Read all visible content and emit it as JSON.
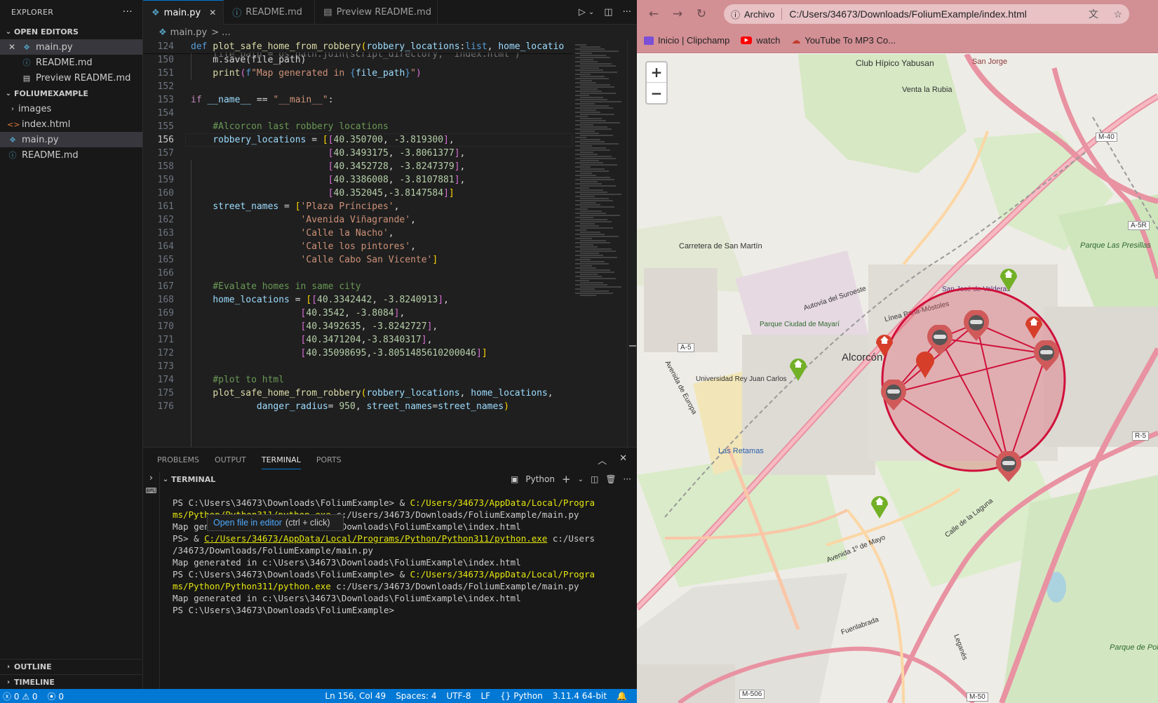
{
  "sidebar": {
    "title": "EXPLORER",
    "open_editors": "OPEN EDITORS",
    "open_files": [
      "main.py",
      "README.md",
      "Preview README.md"
    ],
    "folder": "FOLIUMEXAMPLE",
    "tree": [
      "images",
      "index.html",
      "main.py",
      "README.md"
    ],
    "outline": "OUTLINE",
    "timeline": "TIMELINE"
  },
  "tabs": [
    {
      "label": "main.py"
    },
    {
      "label": "README.md"
    },
    {
      "label": "Preview README.md"
    }
  ],
  "breadcrumb": {
    "file": "main.py",
    "rest": "> ..."
  },
  "editor": {
    "sticky_line": "124",
    "sticky_code": "def plot_safe_home_from_robbery(robbery_locations:list, home_locatio",
    "line_numbers": [
      "150",
      "151",
      "152",
      "153",
      "154",
      "155",
      "156",
      "157",
      "158",
      "159",
      "160",
      "161",
      "162",
      "163",
      "164",
      "165",
      "166",
      "167",
      "168",
      "169",
      "170",
      "171",
      "172",
      "173",
      "174",
      "175",
      "176"
    ]
  },
  "panel": {
    "tabs": [
      "PROBLEMS",
      "OUTPUT",
      "TERMINAL",
      "PORTS"
    ],
    "terminal_title": "TERMINAL",
    "shell": "Python",
    "lines": [
      "PS C:\\Users\\34673\\Downloads\\FoliumExample> & ",
      "C:/Users/34673/AppData/Local/Programs/Python/Python311/python.exe",
      " c:/Users/34673/Downloads/FoliumExample/main.py",
      "Map generated in c:\\Users\\34673\\Downloads\\FoliumExample\\index.html",
      "PS> & ",
      "PS C:\\Users\\34673\\Downloads\\FoliumExample>"
    ],
    "tooltip_link": "Open file in editor",
    "tooltip_hint": "(ctrl + click)"
  },
  "statusbar": {
    "errors": "0",
    "warnings": "0",
    "ports": "0",
    "position": "Ln 156, Col 49",
    "spaces": "Spaces: 4",
    "encoding": "UTF-8",
    "eol": "LF",
    "language": "Python",
    "interpreter": "3.11.4 64-bit"
  },
  "browser": {
    "security_label": "Archivo",
    "url": "C:/Users/34673/Downloads/FoliumExample/index.html",
    "bookmarks": [
      "Inicio | Clipchamp",
      "watch",
      "YouTube To MP3 Co..."
    ]
  },
  "map": {
    "zoom_in": "+",
    "zoom_out": "−",
    "labels": [
      "Club Hípico Yabusan",
      "Venta la Rubia",
      "San Jorge",
      "Alcorcón",
      "Carretera de San Martín",
      "Parque Ciudad de Mayarí",
      "Universidad Rey Juan Carlos",
      "Las Retamas",
      "San José de Valderas",
      "Parque Las Presillas",
      "Avenida 1º de Mayo",
      "Calle de la Laguna",
      "Fuenlabrada",
      "Parque de Polvoranca",
      "Leganés",
      "A-5",
      "M-40",
      "M-50",
      "M-506",
      "R-5",
      "A-5R",
      "Autovía del Suroeste",
      "Línea Parla-Móstoles",
      "Avenida de Europa"
    ],
    "circle_color": "#d0103a",
    "robbery_marker_color": "#d05a5a",
    "safe_home_color": "#72b026",
    "danger_home_color": "#d63e2a"
  },
  "colors": {
    "accent": "#0078d4",
    "browser_frame": "#d28f94"
  }
}
